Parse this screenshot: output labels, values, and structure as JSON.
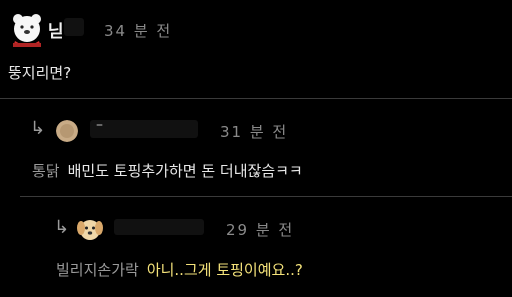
{
  "comments": [
    {
      "author_visible": "닏",
      "time": "34 분 전",
      "text": "뚱지리면?"
    },
    {
      "author_visible": "–",
      "time": "31 분 전",
      "quote": "통닭",
      "text": "배민도 토핑추가하면 돈 더내잖슴ㅋㅋ"
    },
    {
      "author_visible": "",
      "time": "29 분 전",
      "quote": "빌리지손가락",
      "text": "아니..그게 토핑이예요..?"
    }
  ],
  "colors": {
    "background": "#000000",
    "text": "#e8e8e8",
    "muted": "#8a8a8a",
    "highlight": "#f4e27a"
  },
  "icons": {
    "reply": "reply-arrow-icon",
    "bear": "polar-bear-avatar",
    "dog": "puppy-avatar"
  }
}
